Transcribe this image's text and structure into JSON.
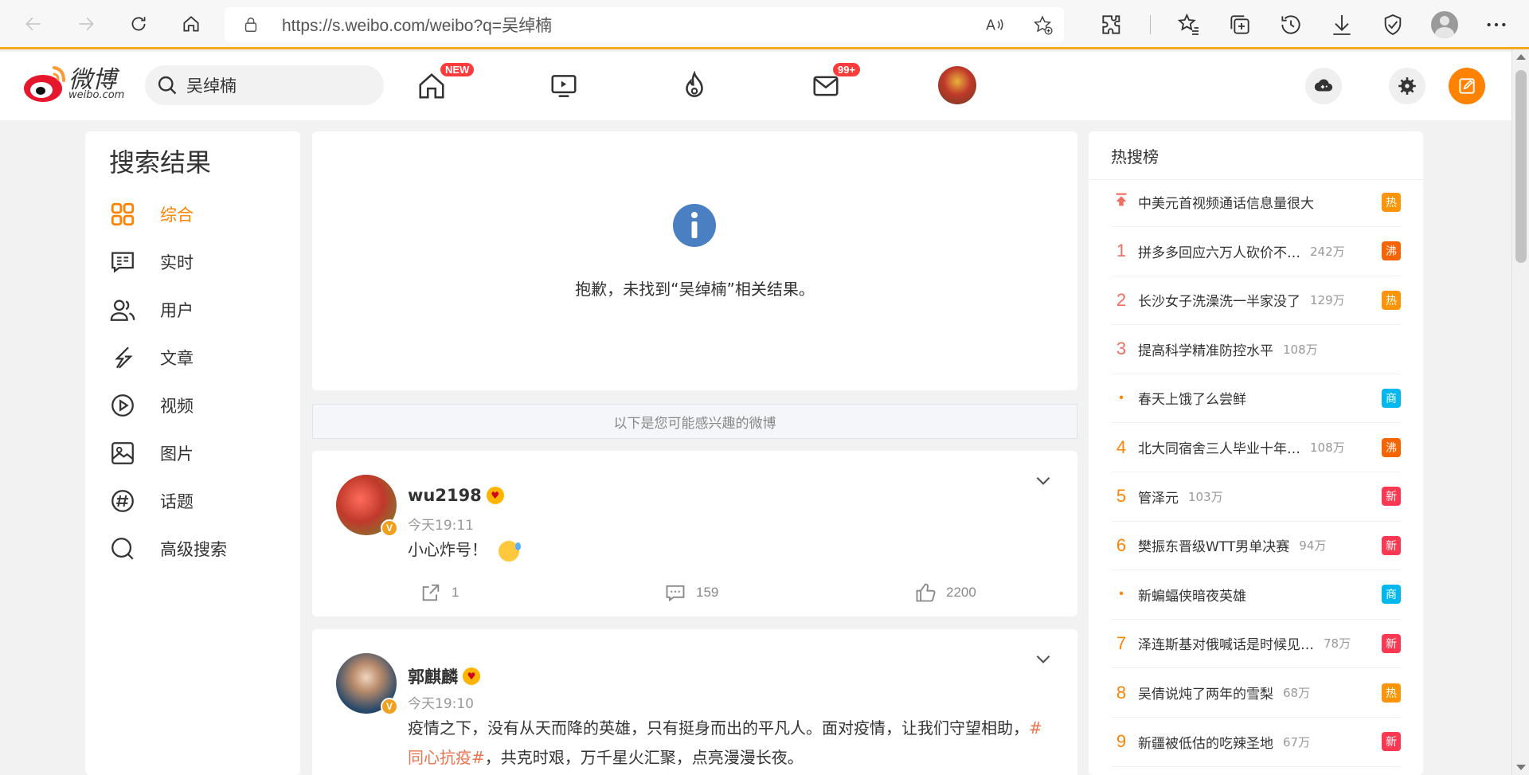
{
  "browser": {
    "url": "https://s.weibo.com/weibo?q=吴绰楠"
  },
  "header": {
    "logo_text": "微博",
    "logo_sub": "weibo.com",
    "search_value": "吴绰楠",
    "badge_new": "NEW",
    "badge_messages": "99+"
  },
  "sidebar": {
    "title": "搜索结果",
    "items": [
      {
        "label": "综合",
        "icon": "grid-icon",
        "active": true
      },
      {
        "label": "实时",
        "icon": "realtime-icon"
      },
      {
        "label": "用户",
        "icon": "users-icon"
      },
      {
        "label": "文章",
        "icon": "article-icon"
      },
      {
        "label": "视频",
        "icon": "video-icon"
      },
      {
        "label": "图片",
        "icon": "image-icon"
      },
      {
        "label": "话题",
        "icon": "topic-icon"
      },
      {
        "label": "高级搜索",
        "icon": "search-icon"
      }
    ]
  },
  "main": {
    "no_result": "抱歉，未找到“吴绰楠”相关结果。",
    "recommend_hint": "以下是您可能感兴趣的微博",
    "posts": [
      {
        "name": "wu2198",
        "time": "今天19:11",
        "text": "小心炸号！",
        "reposts": "1",
        "comments": "159",
        "likes": "2200"
      },
      {
        "name": "郭麒麟",
        "time": "今天19:10",
        "text_a": "疫情之下，没有从天而降的英雄，只有挺身而出的平凡人。面对疫情，让我们守望相助，",
        "tag": "#同心抗疫#",
        "text_b": "，共克时艰，万千星火汇聚，点亮漫漫长夜。"
      }
    ]
  },
  "hot": {
    "title": "热搜榜",
    "items": [
      {
        "rank": "",
        "text": "中美元首视频通话信息量很大",
        "count": "",
        "tag": "热",
        "tag_color": "#ff9406",
        "pinned": true
      },
      {
        "rank": "1",
        "text": "拼多多回应六万人砍价不…",
        "count": "242万",
        "tag": "沸",
        "tag_color": "#f86400"
      },
      {
        "rank": "2",
        "text": "长沙女子洗澡洗一半家没了",
        "count": "129万",
        "tag": "热",
        "tag_color": "#ff9406"
      },
      {
        "rank": "3",
        "text": "提高科学精准防控水平",
        "count": "108万",
        "tag": "",
        "tag_color": ""
      },
      {
        "rank": "•",
        "text": "春天上饿了么尝鲜",
        "count": "",
        "tag": "商",
        "tag_color": "#00b7ee"
      },
      {
        "rank": "4",
        "text": "北大同宿舍三人毕业十年…",
        "count": "108万",
        "tag": "沸",
        "tag_color": "#f86400"
      },
      {
        "rank": "5",
        "text": "管泽元",
        "count": "103万",
        "tag": "新",
        "tag_color": "#ff3852"
      },
      {
        "rank": "6",
        "text": "樊振东晋级WTT男单决赛",
        "count": "94万",
        "tag": "新",
        "tag_color": "#ff3852"
      },
      {
        "rank": "•",
        "text": "新蝙蝠侠暗夜英雄",
        "count": "",
        "tag": "商",
        "tag_color": "#00b7ee"
      },
      {
        "rank": "7",
        "text": "泽连斯基对俄喊话是时候见…",
        "count": "78万",
        "tag": "新",
        "tag_color": "#ff3852"
      },
      {
        "rank": "8",
        "text": "吴倩说炖了两年的雪梨",
        "count": "68万",
        "tag": "热",
        "tag_color": "#ff9406"
      },
      {
        "rank": "9",
        "text": "新疆被低估的吃辣圣地",
        "count": "67万",
        "tag": "新",
        "tag_color": "#ff3852"
      }
    ]
  },
  "colors": {
    "accent": "#ff8200",
    "info_blue": "#4a7fc1",
    "rank_red": "#f26d5f",
    "rank_orange": "#ff8200"
  }
}
